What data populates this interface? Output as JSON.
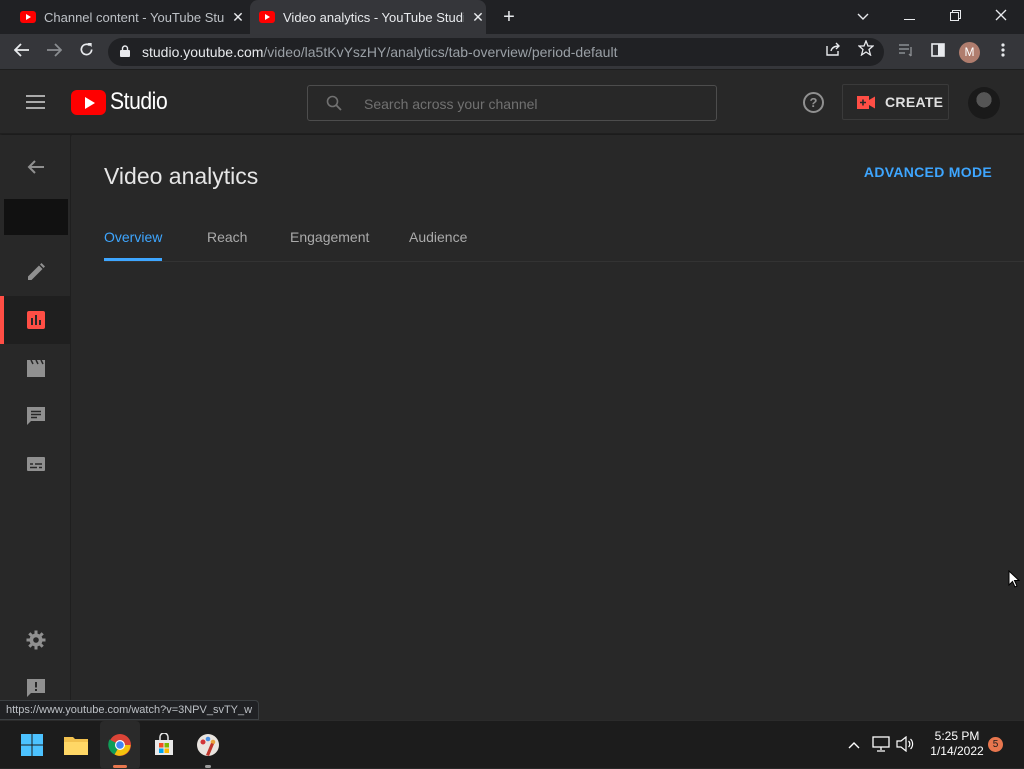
{
  "browser": {
    "tabs": [
      {
        "title": "Channel content - YouTube Studio",
        "active": false
      },
      {
        "title": "Video analytics - YouTube Studio",
        "active": true
      }
    ],
    "url_host": "studio.youtube.com",
    "url_path": "/video/la5tKvYszHY/analytics/tab-overview/period-default",
    "profile_initial": "M",
    "status_url": "https://www.youtube.com/watch?v=3NPV_svTY_w"
  },
  "header": {
    "logo_text": "Studio",
    "search_placeholder": "Search across your channel",
    "help_glyph": "?",
    "create_label": "CREATE"
  },
  "main": {
    "title": "Video analytics",
    "advanced_mode_label": "ADVANCED MODE",
    "tabs": [
      {
        "label": "Overview",
        "active": true
      },
      {
        "label": "Reach",
        "active": false
      },
      {
        "label": "Engagement",
        "active": false
      },
      {
        "label": "Audience",
        "active": false
      }
    ]
  },
  "taskbar": {
    "time": "5:25 PM",
    "date": "1/14/2022",
    "notification_count": "5"
  },
  "colors": {
    "accent": "#3ea6ff",
    "brand_red": "#ff0000",
    "active_indicator": "#ff4e45",
    "background": "#282828"
  }
}
